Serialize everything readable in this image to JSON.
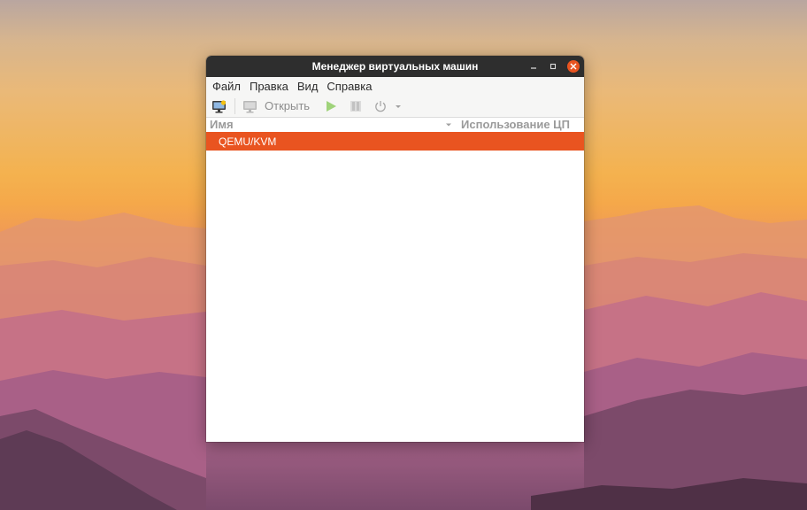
{
  "window": {
    "title": "Менеджер виртуальных машин",
    "controls": {
      "minimize": "–",
      "maximize": "□",
      "close": "×"
    }
  },
  "menubar": {
    "items": [
      {
        "label": "Файл"
      },
      {
        "label": "Правка"
      },
      {
        "label": "Вид"
      },
      {
        "label": "Справка"
      }
    ]
  },
  "toolbar": {
    "new_vm_icon": "monitor-new-icon",
    "open_icon": "monitor-icon",
    "open_label": "Открыть",
    "run_icon": "play-icon",
    "pause_icon": "pause-icon",
    "shutdown_icon": "power-icon",
    "shutdown_menu_icon": "chevron-down-icon"
  },
  "list": {
    "columns": {
      "name": "Имя",
      "cpu": "Использование ЦП"
    },
    "rows": [
      {
        "name": "QEMU/KVM",
        "selected": true
      }
    ]
  },
  "colors": {
    "accent": "#e95420",
    "titlebar": "#2e2e2e",
    "run_green": "#9fd37a"
  }
}
